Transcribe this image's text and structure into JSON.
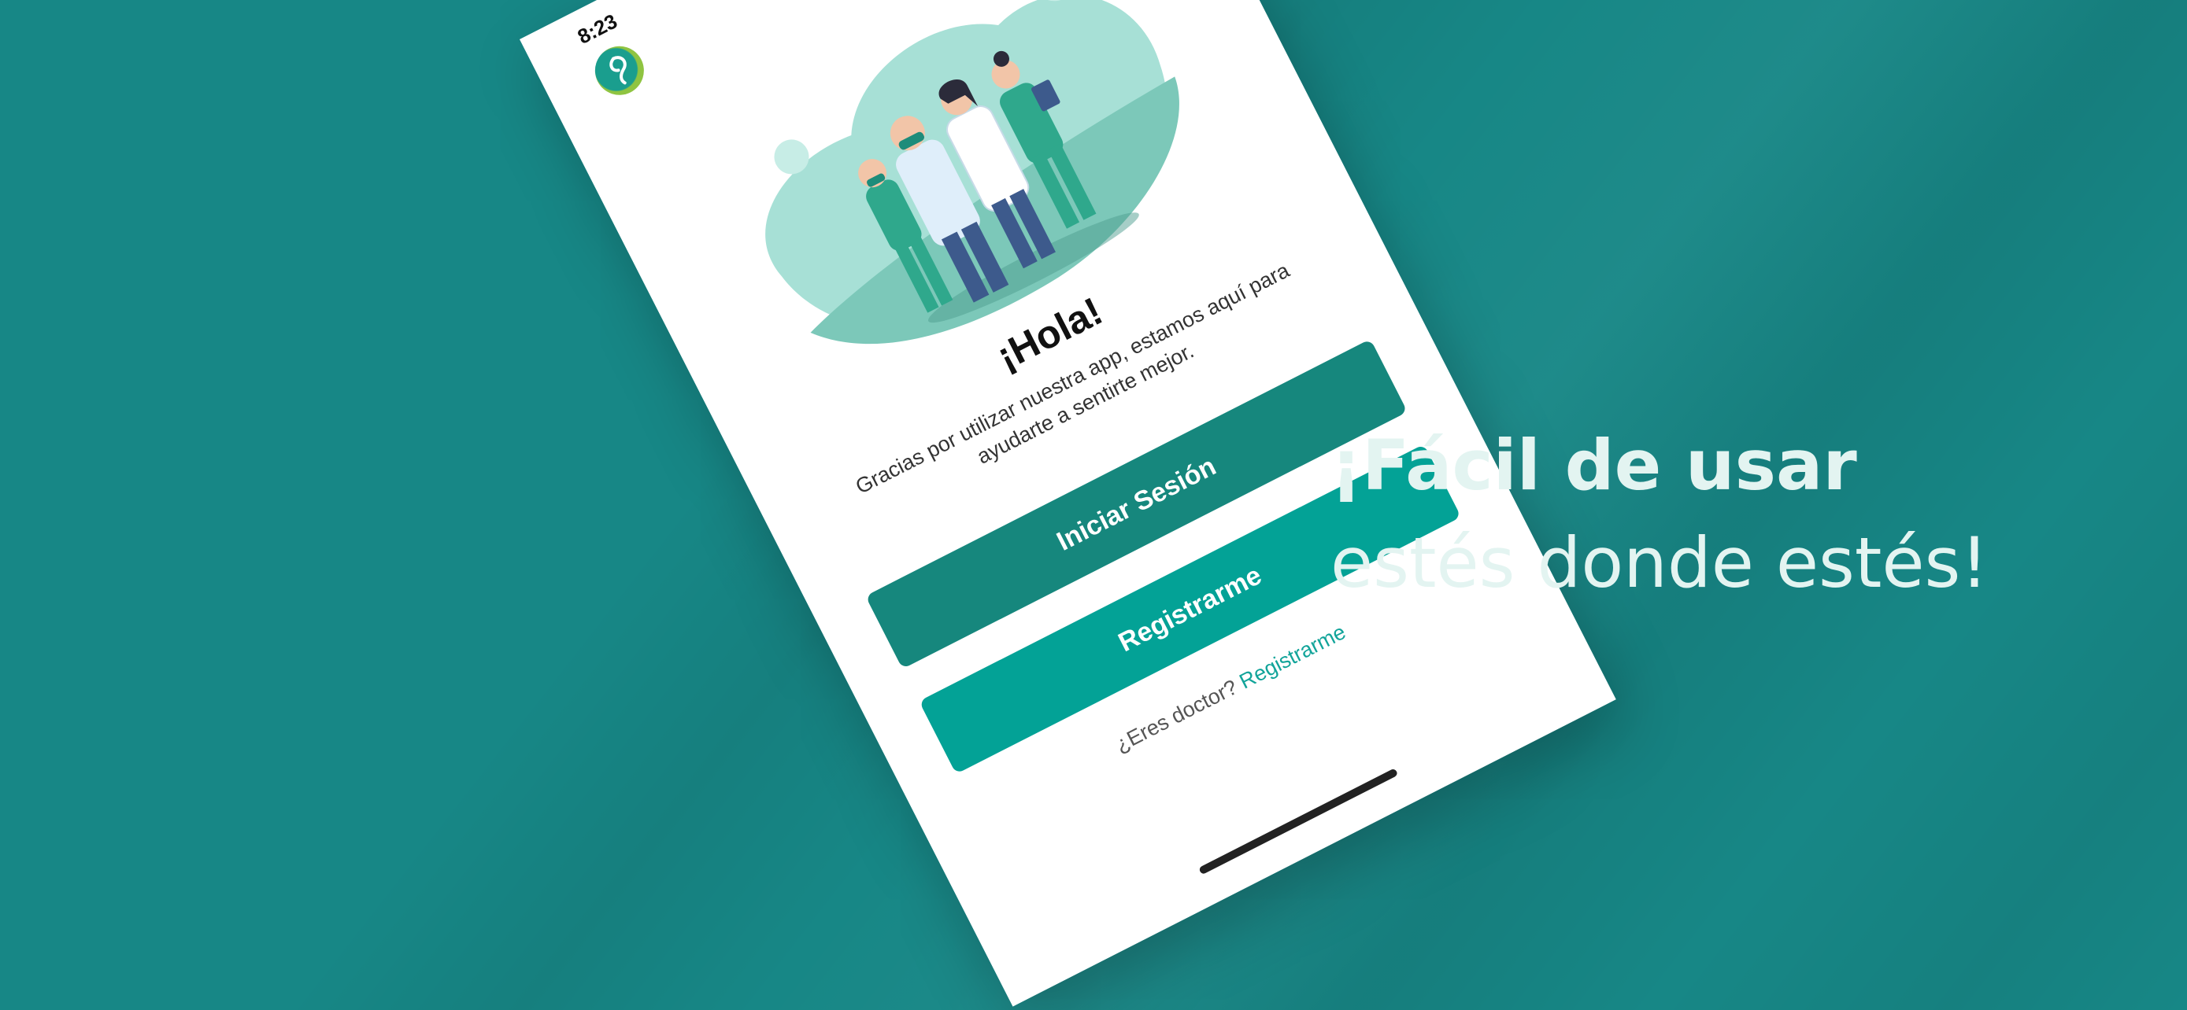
{
  "status_bar": {
    "time": "8:23"
  },
  "welcome": {
    "greeting": "¡Hola!",
    "message": "Gracias por utilizar nuestra app, estamos aquí para ayudarte a sentirte mejor.",
    "login_button": "Iniciar Sesión",
    "register_button": "Registrarme",
    "doctor_prompt": "¿Eres doctor?",
    "doctor_link": "Registrarme"
  },
  "promo": {
    "line1": "¡Fácil de usar",
    "line2": "estés donde estés!"
  },
  "colors": {
    "background": "#178786",
    "primary_button": "#16877d",
    "secondary_button": "#03a296",
    "link": "#12a49a"
  }
}
